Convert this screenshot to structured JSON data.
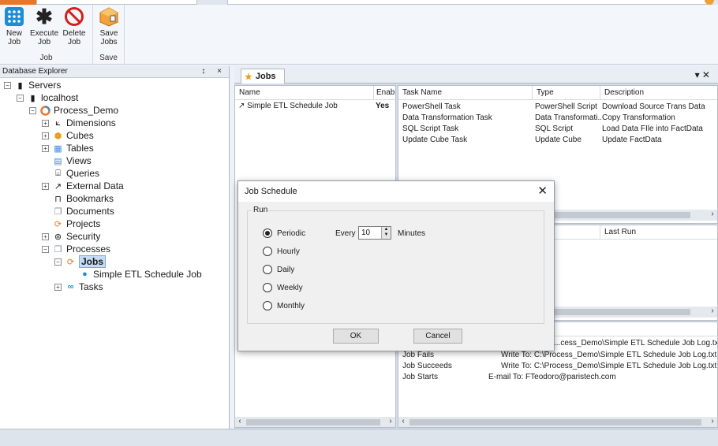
{
  "ribbon": {
    "groups": [
      {
        "label": "Job",
        "buttons": [
          {
            "label": "New Job",
            "icon": "new-job-icon"
          },
          {
            "label": "Execute Job",
            "icon": "asterisk-icon"
          },
          {
            "label": "Delete Job",
            "icon": "prohibited-icon"
          }
        ]
      },
      {
        "label": "Save",
        "buttons": [
          {
            "label": "Save Jobs",
            "icon": "save-jobs-icon"
          }
        ]
      }
    ]
  },
  "explorer": {
    "title": "Database Explorer",
    "controls": "↕ ×",
    "nodes": {
      "servers": "Servers",
      "localhost": "localhost",
      "process_demo": "Process_Demo",
      "dimensions": "Dimensions",
      "cubes": "Cubes",
      "tables": "Tables",
      "views": "Views",
      "queries": "Queries",
      "external_data": "External Data",
      "bookmarks": "Bookmarks",
      "documents": "Documents",
      "projects": "Projects",
      "security": "Security",
      "processes": "Processes",
      "jobs": "Jobs",
      "job_item": "Simple ETL Schedule  Job",
      "tasks": "Tasks"
    }
  },
  "doc_tab": {
    "label": "Jobs"
  },
  "jobs_list": {
    "columns": [
      "Name",
      "Enabl"
    ],
    "rows": [
      {
        "name": "Simple ETL Schedule  Job",
        "enabled": "Yes"
      }
    ]
  },
  "tasks": {
    "columns": [
      "Task Name",
      "Type",
      "Description"
    ],
    "rows": [
      {
        "name": "PowerShell Task",
        "type": "PowerShell Script",
        "desc": "Download Source Trans Data"
      },
      {
        "name": "Data Transformation Task",
        "type": "Data Transformati...",
        "desc": "Copy Transformation"
      },
      {
        "name": "SQL Script Task",
        "type": "SQL Script",
        "desc": "Load Data FIle into FactData"
      },
      {
        "name": "Update Cube Task",
        "type": "Update Cube",
        "desc": "Update FactData"
      }
    ]
  },
  "schedule_pane": {
    "last_run_header": "Last Run"
  },
  "notifications": {
    "rows": [
      {
        "event": "",
        "action": "...cess_Demo\\Simple ETL Schedule  Job Log.txt"
      },
      {
        "event": "Job Fails",
        "action": "Write To: C:\\Process_Demo\\Simple ETL Schedule  Job Log.txt"
      },
      {
        "event": "Job Succeeds",
        "action": "Write To: C:\\Process_Demo\\Simple ETL Schedule  Job Log.txt"
      },
      {
        "event": "Job Starts",
        "action": "E-mail To: FTeodoro@paristech.com"
      }
    ]
  },
  "dialog": {
    "title": "Job Schedule",
    "group_label": "Run",
    "options": [
      "Periodic",
      "Hourly",
      "Daily",
      "Weekly",
      "Monthly"
    ],
    "selected": "Periodic",
    "every_label": "Every",
    "every_value": "10",
    "unit_label": "Minutes",
    "ok_label": "OK",
    "cancel_label": "Cancel"
  },
  "colors": {
    "accent": "#e8772e",
    "selection": "#c4dcf7",
    "ribbon_bg": "#f3f6fa"
  }
}
